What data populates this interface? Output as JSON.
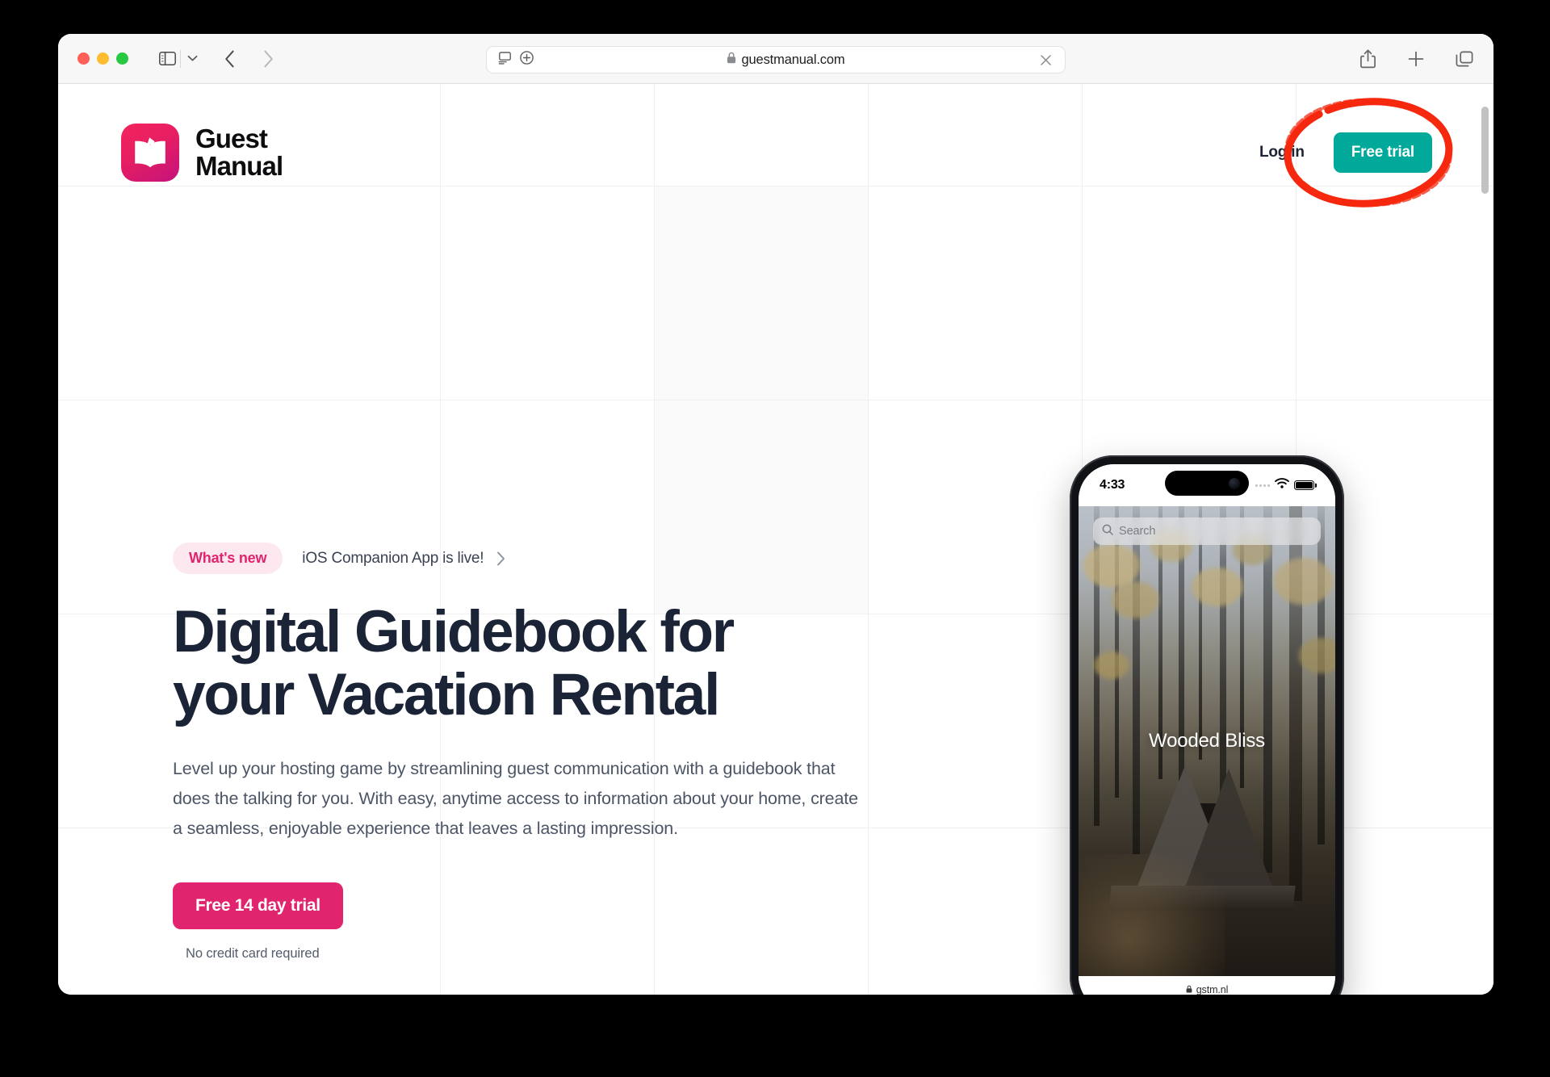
{
  "browser": {
    "traffic_lights": [
      "close",
      "minimize",
      "zoom"
    ],
    "sidebar_button": "sidebar-toggle",
    "back_button": "back",
    "forward_button": "forward",
    "url": "guestmanual.com",
    "url_lock": "secure",
    "url_clear": "clear",
    "reader_icon": "reader-view-icon",
    "extension_icon": "add-extension-icon",
    "right_actions": [
      "share",
      "new-tab",
      "tab-overview"
    ]
  },
  "site": {
    "brand": {
      "line1": "Guest",
      "line2": "Manual",
      "mark_icon": "open-book-icon",
      "mark_color": "#e61e62"
    },
    "nav": {
      "login_label": "Log in",
      "free_trial_label": "Free trial",
      "free_trial_color": "#00a99a"
    },
    "annotation": {
      "type": "hand-drawn-ellipse",
      "color": "#f5280f",
      "target": "free-trial-button"
    }
  },
  "hero": {
    "whats_new_badge": "What's new",
    "whats_new_text": "iOS Companion App is live!",
    "whats_new_chevron": "chevron-right-icon",
    "heading": "Digital Guidebook for your Vacation Rental",
    "subheading": "Level up your hosting game by streamlining guest communication with a guidebook that does the talking for you. With easy, anytime access to information about your home, create a seamless, enjoyable experience that leaves a lasting impression.",
    "cta_label": "Free 14 day trial",
    "cta_color": "#e0246e",
    "cta_note": "No credit card required"
  },
  "phone": {
    "status_time": "4:33",
    "wifi_icon": "wifi-icon",
    "battery_icon": "battery-icon",
    "search_placeholder": "Search",
    "search_icon": "search-icon",
    "listing_title": "Wooded Bliss",
    "bottom_url": "gstm.nl",
    "bottom_lock_icon": "lock-icon"
  }
}
